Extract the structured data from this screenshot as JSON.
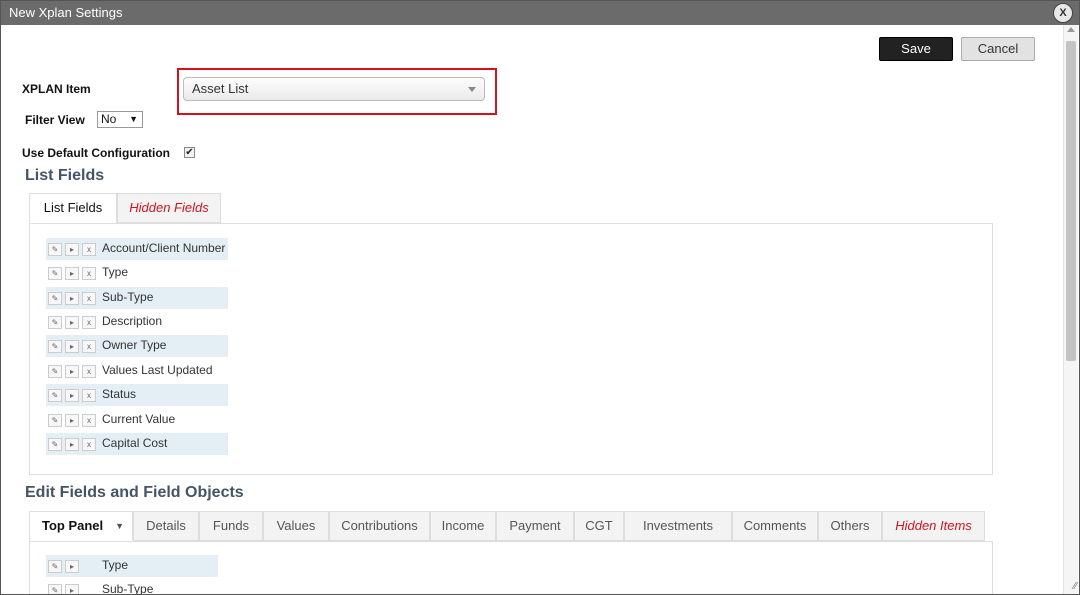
{
  "window": {
    "title": "New Xplan Settings",
    "close_label": "X"
  },
  "toolbar": {
    "save_label": "Save",
    "cancel_label": "Cancel"
  },
  "form": {
    "xplan_item_label": "XPLAN Item",
    "xplan_item_value": "Asset List",
    "filter_view_label": "Filter View",
    "filter_view_value": "No",
    "use_default_label": "Use Default Configuration",
    "use_default_checked": true
  },
  "list_fields": {
    "heading": "List Fields",
    "tabs": [
      "List Fields",
      "Hidden Fields"
    ],
    "items": [
      "Account/Client Number",
      "Type",
      "Sub-Type",
      "Description",
      "Owner Type",
      "Values Last Updated",
      "Status",
      "Current Value",
      "Capital Cost"
    ]
  },
  "edit_fields": {
    "heading": "Edit Fields and Field Objects",
    "tabs": [
      "Top Panel",
      "Details",
      "Funds",
      "Values",
      "Contributions",
      "Income",
      "Payment",
      "CGT",
      "Investments",
      "Comments",
      "Others",
      "Hidden Items"
    ],
    "items": [
      "Type",
      "Sub-Type"
    ]
  },
  "colors": {
    "accent_red": "#d0141c",
    "heading": "#445566",
    "row_shade": "#e4eef5"
  }
}
